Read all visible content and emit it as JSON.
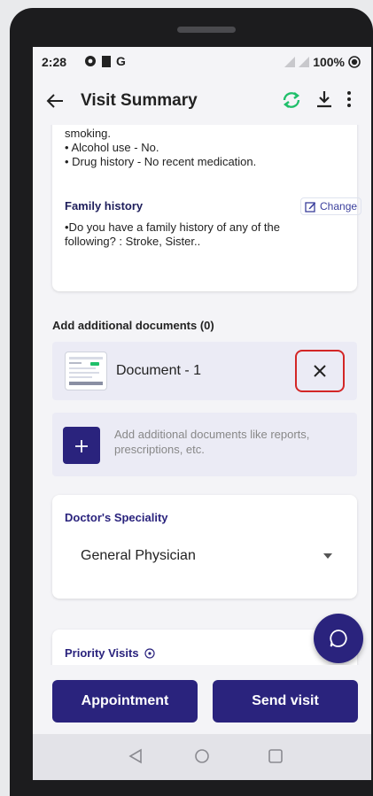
{
  "status_bar": {
    "time": "2:28",
    "battery": "100%",
    "left_icons": [
      "gear-icon",
      "square-icon",
      "g-icon"
    ],
    "right_icons": [
      "signal-icon",
      "signal-icon",
      "battery-icon"
    ]
  },
  "app_bar": {
    "title": "Visit Summary",
    "actions": [
      "sync-icon",
      "download-icon",
      "more-icon"
    ]
  },
  "history_card": {
    "lines": [
      "smoking.",
      "• Alcohol use - No.",
      "• Drug history - No recent medication."
    ],
    "family_history_label": "Family history",
    "change_label": "Change",
    "family_history_text": "•Do you have a family history of any of the following? : Stroke, Sister.."
  },
  "documents": {
    "section_title": "Add additional documents (0)",
    "items": [
      {
        "name": "Document - 1"
      }
    ],
    "add_hint": "Add additional documents like reports, prescriptions, etc."
  },
  "speciality": {
    "label": "Doctor's Speciality",
    "selected": "General Physician"
  },
  "priority": {
    "label": "Priority Visits"
  },
  "buttons": {
    "appointment": "Appointment",
    "send_visit": "Send visit"
  },
  "colors": {
    "primary": "#2a237d",
    "accent_green": "#1fbf6a",
    "highlight_red": "#d32626"
  }
}
